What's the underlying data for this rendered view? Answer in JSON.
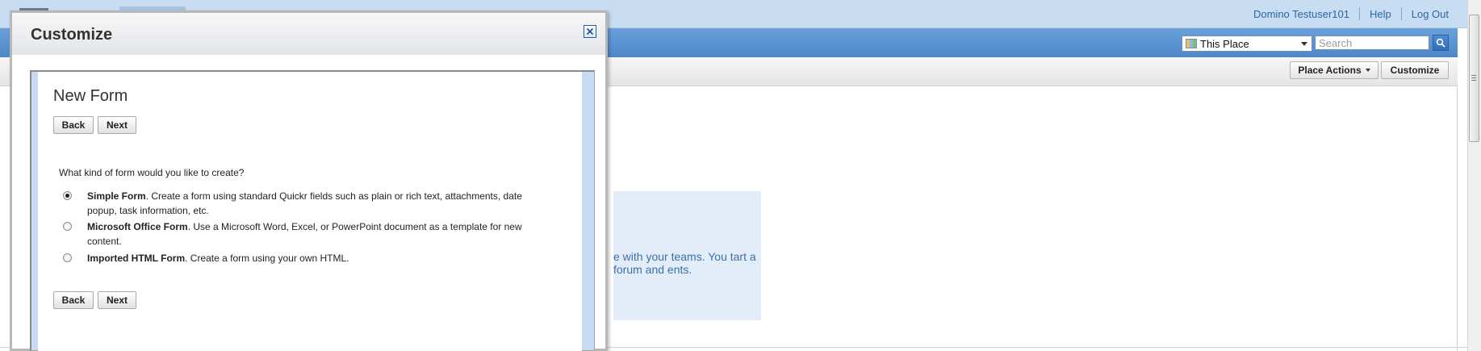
{
  "header": {
    "user_name": "Domino Testuser101",
    "help_link": "Help",
    "logout_link": "Log Out"
  },
  "search": {
    "scope_value": "This Place",
    "placeholder": "Search"
  },
  "actions": {
    "place_actions": "Place Actions",
    "customize": "Customize"
  },
  "welcome": {
    "text": "e with your teams. You tart a forum and ents."
  },
  "dialog": {
    "title": "Customize",
    "form_title": "New Form",
    "back_label": "Back",
    "next_label": "Next",
    "question": "What kind of form would you like to create?",
    "options": [
      {
        "name": "Simple Form",
        "description": ". Create a form using standard Quickr fields such as plain or rich text, attachments, date popup, task information, etc.",
        "selected": true
      },
      {
        "name": "Microsoft Office Form",
        "description": ". Use a Microsoft Word, Excel, or PowerPoint document as a template for new content.",
        "selected": false
      },
      {
        "name": "Imported HTML Form",
        "description": ". Create a form using your own HTML.",
        "selected": false
      }
    ]
  }
}
